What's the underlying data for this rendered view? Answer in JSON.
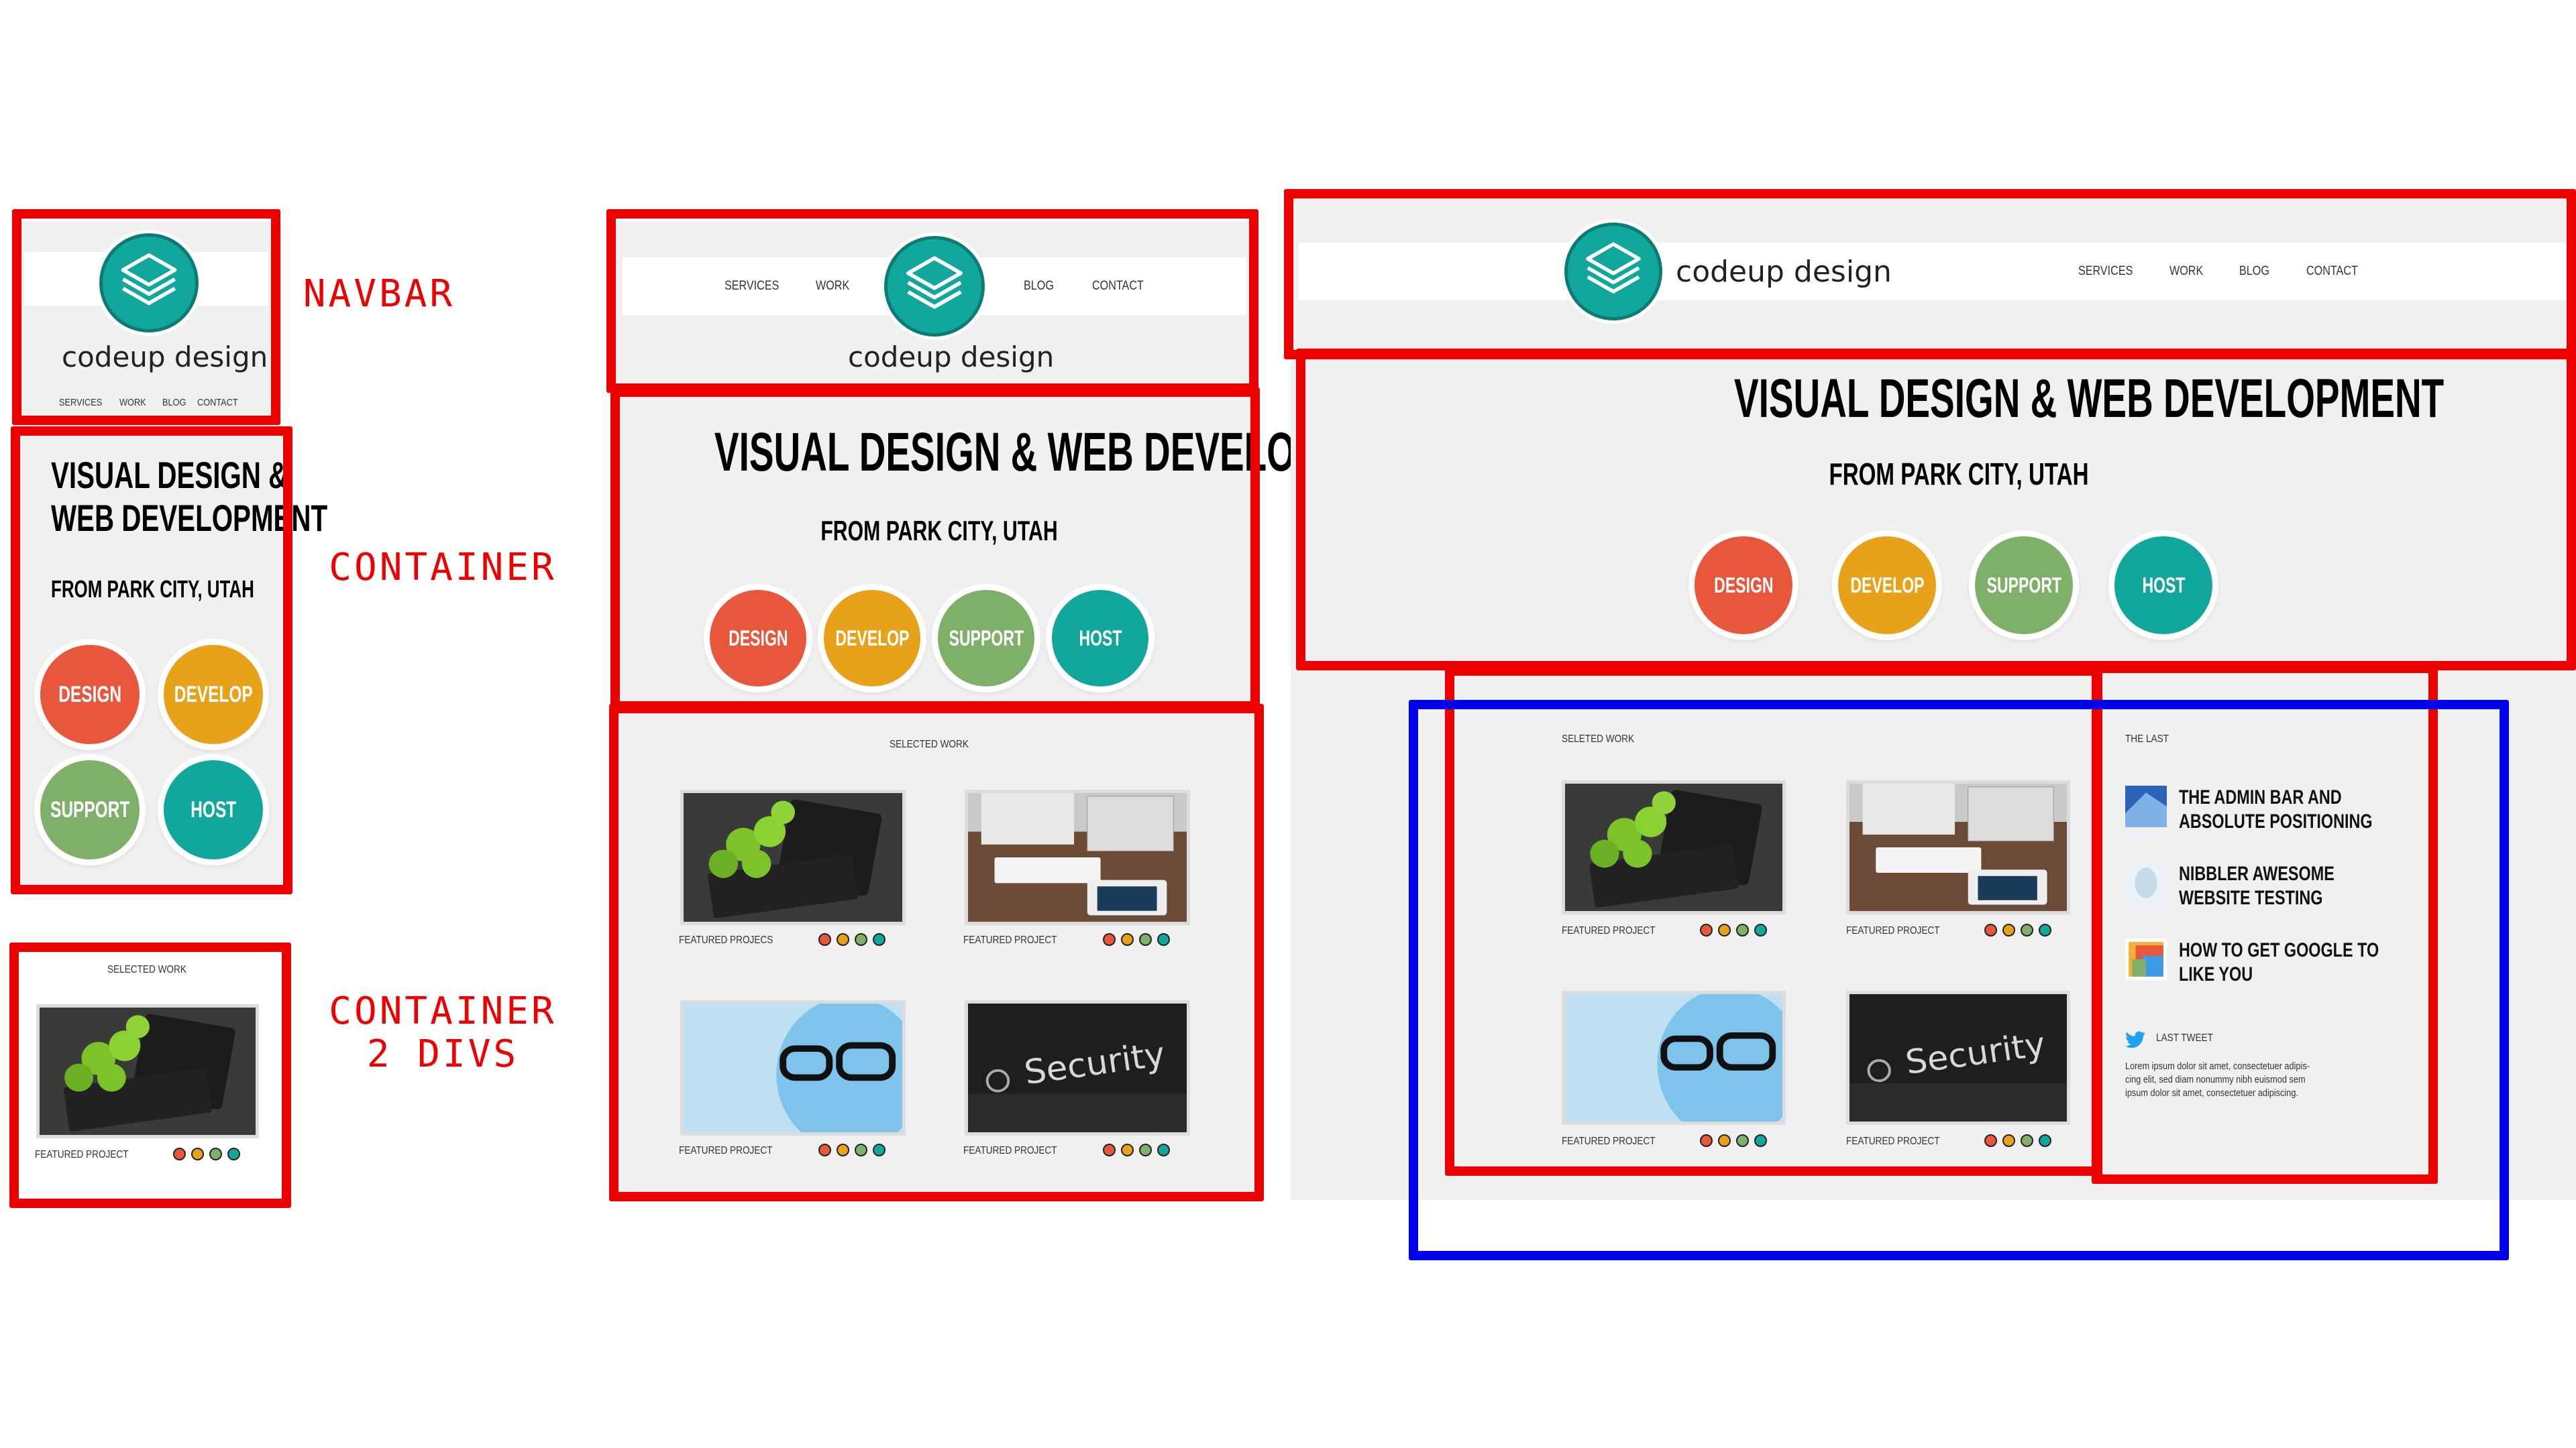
{
  "colors": {
    "annotation_red": "#ee0000",
    "annotation_blue": "#0000ee",
    "design": "#e8573c",
    "develop": "#e8a21a",
    "support": "#7fb069",
    "host": "#12a79d",
    "logo": "#12a79d"
  },
  "labels": {
    "navbar": "NAVBAR",
    "container": "CONTAINER",
    "container_2divs_line1": "CONTAINER",
    "container_2divs_line2": "2 DIVS"
  },
  "brand": "codeup design",
  "nav": {
    "services": "SERVICES",
    "work": "WORK",
    "blog": "BLOG",
    "contact": "CONTACT"
  },
  "hero": {
    "title": "VISUAL DESIGN & WEB DEVELOPMENT",
    "mobile_title_line1": "VISUAL DESIGN &",
    "mobile_title_line2": "WEB DEVELOPMENT",
    "subtitle": "FROM PARK CITY, UTAH"
  },
  "services": [
    "DESIGN",
    "DEVELOP",
    "SUPPORT",
    "HOST"
  ],
  "work": {
    "heading_mobile": "SELECTED WORK",
    "heading_tablet": "SELECTED WORK",
    "heading_desktop": "SELETED WORK",
    "caption_default": "FEATURED PROJECT",
    "caption_tablet_first": "FEATURED PROJECS"
  },
  "sidebar": {
    "heading": "THE LAST",
    "posts": [
      "THE ADMIN BAR AND ABSOLUTE POSITIONING",
      "NIBBLER AWESOME WEBSITE TESTING",
      "HOW TO GET GOOGLE TO LIKE YOU"
    ],
    "tweet_label": "LAST TWEET",
    "tweet_line1": "Lorem ipsum dolor sit amet, consectetuer adipis-",
    "tweet_line2": "cing elit, sed diam nonummy nibh euismod sem",
    "tweet_line3": "ipsum dolor sit amet, consectetuer adipiscing."
  },
  "icons": [
    "layers-icon",
    "twitter-icon"
  ]
}
